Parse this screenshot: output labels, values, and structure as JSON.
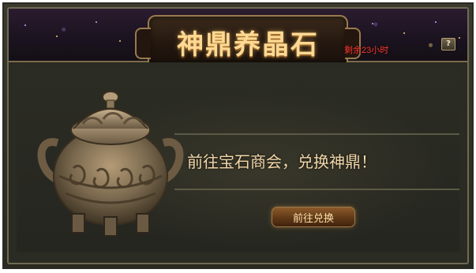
{
  "window": {
    "title": "神鼎养晶石",
    "time_remaining": "剩余23小时",
    "help_label": "?"
  },
  "content": {
    "message": "前往宝石商会，兑换神鼎！",
    "action_button_label": "前往兑换",
    "item_icon": "bronze-cauldron-icon"
  },
  "colors": {
    "title": "#ffd993",
    "timer": "#ff3a2f",
    "message": "#f1d6a8",
    "button_text": "#ffe0a8"
  }
}
